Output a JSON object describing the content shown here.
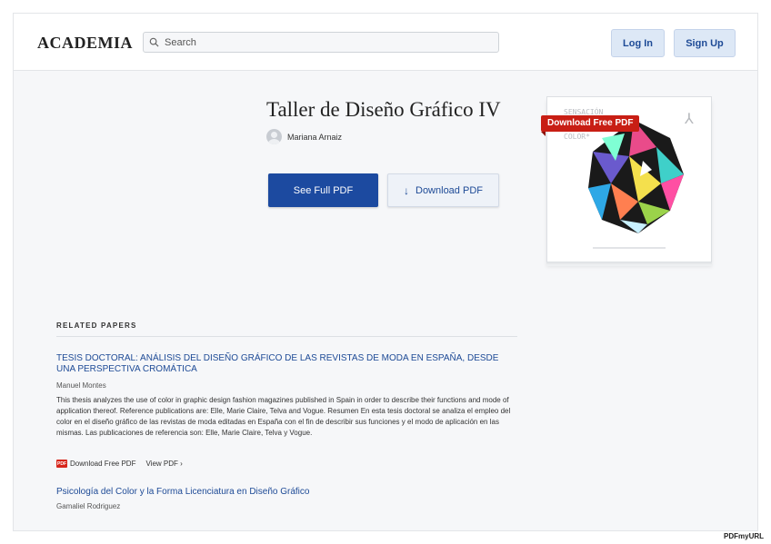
{
  "header": {
    "logo": "ACADEMIA",
    "search_placeholder": "Search",
    "login_label": "Log In",
    "signup_label": "Sign Up"
  },
  "document": {
    "title": "Taller de Diseño Gráfico IV",
    "author": "Mariana Arnaiz",
    "see_full_pdf_label": "See Full PDF",
    "download_pdf_label": "Download PDF",
    "download_badge": "Download Free PDF",
    "thumbnail_text": "SENSACIÓN\nAPLICACIÓN\nDEL\nCOLOR*"
  },
  "related": {
    "heading": "RELATED PAPERS",
    "papers": [
      {
        "title": "TESIS DOCTORAL: ANÁLISIS DEL DISEÑO GRÁFICO DE LAS REVISTAS DE MODA EN ESPAÑA, DESDE UNA PERSPECTIVA CROMÁTICA",
        "author": "Manuel Montes",
        "abstract": "This thesis analyzes the use of color in graphic design fashion magazines published in Spain in order to describe their functions and mode of application thereof. Reference publications are: Elle, Marie Claire, Telva and Vogue. Resumen En esta tesis doctoral se analiza el empleo del color en el diseño gráfico de las revistas de moda editadas en España con el fin de describir sus funciones y el modo de aplicación en las mismas. Las publicaciones de referencia son: Elle, Marie Claire, Telva y Vogue.",
        "download_label": "Download Free PDF",
        "view_label": "View PDF ›"
      },
      {
        "title": "Psicología del Color y la Forma Licenciatura en Diseño Gráfico",
        "author": "Gamaliel Rodriguez"
      }
    ]
  },
  "footer": {
    "brand": "PDFmyURL"
  },
  "colors": {
    "brand_blue": "#1c4aa0",
    "badge_red": "#c81e14",
    "link_blue": "#1d4a96"
  }
}
